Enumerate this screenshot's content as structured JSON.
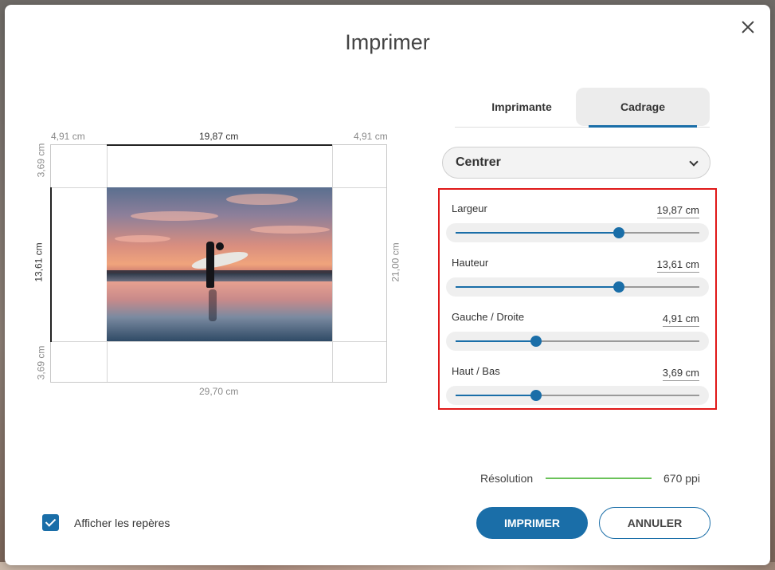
{
  "dialog": {
    "title": "Imprimer",
    "close_label": "×"
  },
  "preview": {
    "margin_left_top": "4,91 cm",
    "width_top": "19,87 cm",
    "margin_right_top": "4,91 cm",
    "margin_top_left": "3,69 cm",
    "height_left": "13,61 cm",
    "margin_bottom_left": "3,69 cm",
    "paper_height_right": "21,00 cm",
    "paper_width_bottom": "29,70 cm"
  },
  "tabs": [
    {
      "label": "Imprimante",
      "active": false
    },
    {
      "label": "Cadrage",
      "active": true
    }
  ],
  "position_select": {
    "value": "Centrer"
  },
  "sliders": [
    {
      "label": "Largeur",
      "value": "19,87 cm",
      "level": 0.67
    },
    {
      "label": "Hauteur",
      "value": "13,61 cm",
      "level": 0.67
    },
    {
      "label": "Gauche / Droite",
      "value": "4,91 cm",
      "level": 0.33
    },
    {
      "label": "Haut / Bas",
      "value": "3,69 cm",
      "level": 0.33
    }
  ],
  "resolution": {
    "label": "Résolution",
    "value": "670 ppi",
    "color": "#6ac259"
  },
  "guides_checkbox": {
    "label": "Afficher les repères",
    "checked": true
  },
  "buttons": {
    "print": "IMPRIMER",
    "cancel": "ANNULER"
  },
  "colors": {
    "accent": "#1a6ea8",
    "highlight_box": "#e01818"
  }
}
